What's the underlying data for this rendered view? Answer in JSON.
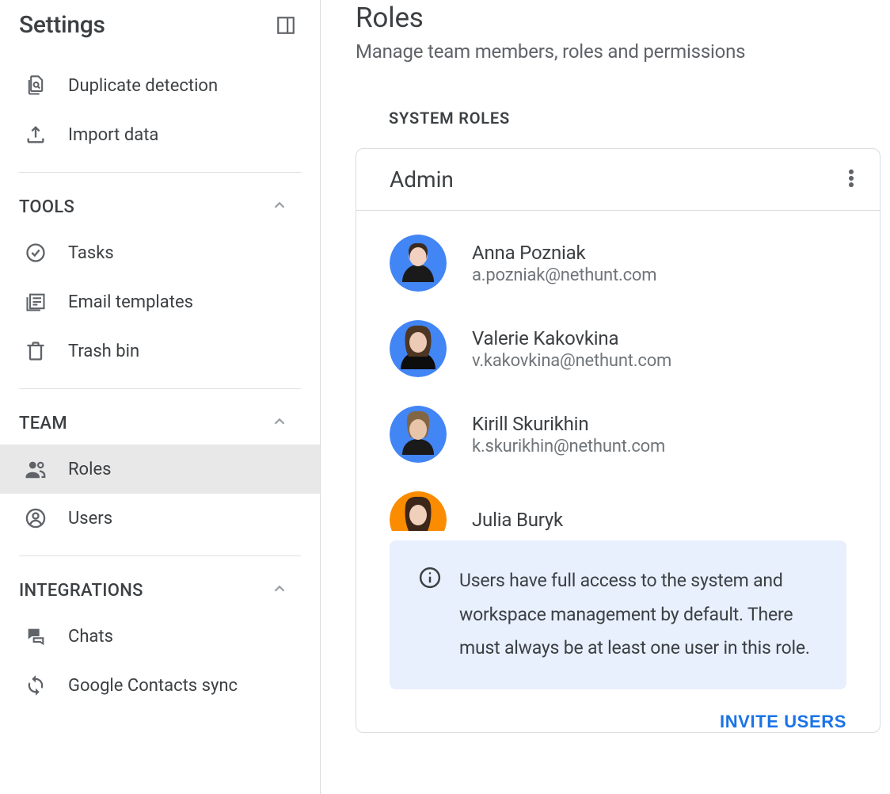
{
  "sidebar": {
    "title": "Settings",
    "items_top": [
      {
        "label": "Duplicate detection",
        "icon": "duplicate-detection"
      },
      {
        "label": "Import data",
        "icon": "import-data"
      }
    ],
    "sections": {
      "tools": {
        "title": "TOOLS",
        "items": [
          {
            "label": "Tasks",
            "icon": "tasks"
          },
          {
            "label": "Email templates",
            "icon": "email-templates"
          },
          {
            "label": "Trash bin",
            "icon": "trash-bin"
          }
        ]
      },
      "team": {
        "title": "TEAM",
        "items": [
          {
            "label": "Roles",
            "icon": "roles",
            "active": true
          },
          {
            "label": "Users",
            "icon": "users",
            "active": false
          }
        ]
      },
      "integrations": {
        "title": "INTEGRATIONS",
        "items": [
          {
            "label": "Chats",
            "icon": "chats"
          },
          {
            "label": "Google Contacts sync",
            "icon": "contacts-sync"
          }
        ]
      }
    }
  },
  "main": {
    "title": "Roles",
    "subtitle": "Manage team members, roles and permissions",
    "system_roles_label": "SYSTEM ROLES",
    "role_card": {
      "name": "Admin",
      "users": [
        {
          "name": "Anna Pozniak",
          "email": "a.pozniak@nethunt.com",
          "avatar_bg": "#4285f4"
        },
        {
          "name": "Valerie Kakovkina",
          "email": "v.kakovkina@nethunt.com",
          "avatar_bg": "#4285f4"
        },
        {
          "name": "Kirill Skurikhin",
          "email": "k.skurikhin@nethunt.com",
          "avatar_bg": "#4285f4"
        },
        {
          "name": "Julia Buryk",
          "email": "",
          "avatar_bg": "#fb8c00"
        }
      ],
      "info": "Users have full access to the system and workspace management by default. There must always be at least one user in this role.",
      "invite_label": "INVITE USERS"
    }
  }
}
